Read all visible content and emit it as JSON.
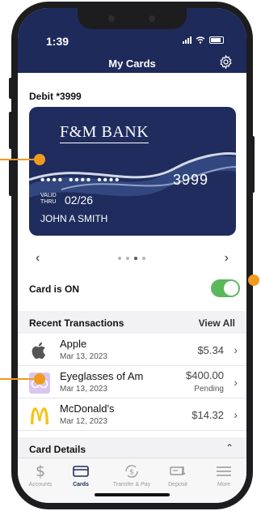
{
  "status": {
    "time": "1:39"
  },
  "header": {
    "title": "My Cards",
    "settings_icon": "gear-icon"
  },
  "card": {
    "account_label": "Debit *3999",
    "bank_name": "F&M BANK",
    "masked_number": "•••• •••• ••••",
    "last4": "3999",
    "valid_thru_label": "VALID THRU",
    "expiry": "02/26",
    "holder": "JOHN A SMITH",
    "pager": {
      "total": 4,
      "active_index": 2
    },
    "status_label": "Card is ON",
    "enabled": true
  },
  "transactions": {
    "section_label": "Recent Transactions",
    "view_all_label": "View All",
    "items": [
      {
        "name": "Apple",
        "date": "Mar 13, 2023",
        "amount": "$5.34",
        "status": "",
        "icon": "apple-logo-icon"
      },
      {
        "name": "Eyeglasses of Am",
        "date": "Mar 13, 2023",
        "amount": "$400.00",
        "status": "Pending",
        "icon": "eyeglasses-logo-icon"
      },
      {
        "name": "McDonald's",
        "date": "Mar 12, 2023",
        "amount": "$14.32",
        "status": "",
        "icon": "mcdonalds-logo-icon"
      }
    ]
  },
  "card_details": {
    "label": "Card Details"
  },
  "tabs": [
    {
      "label": "Accounts",
      "icon": "dollar-icon"
    },
    {
      "label": "Cards",
      "icon": "card-icon",
      "active": true
    },
    {
      "label": "Transfer & Pay",
      "icon": "transfer-icon"
    },
    {
      "label": "Deposit",
      "icon": "deposit-check-icon"
    },
    {
      "label": "More",
      "icon": "menu-icon"
    }
  ],
  "colors": {
    "header": "#1e2a5a",
    "card": "#1f2c5d",
    "toggle_on": "#5cb85c",
    "callout": "#f29a1f"
  }
}
